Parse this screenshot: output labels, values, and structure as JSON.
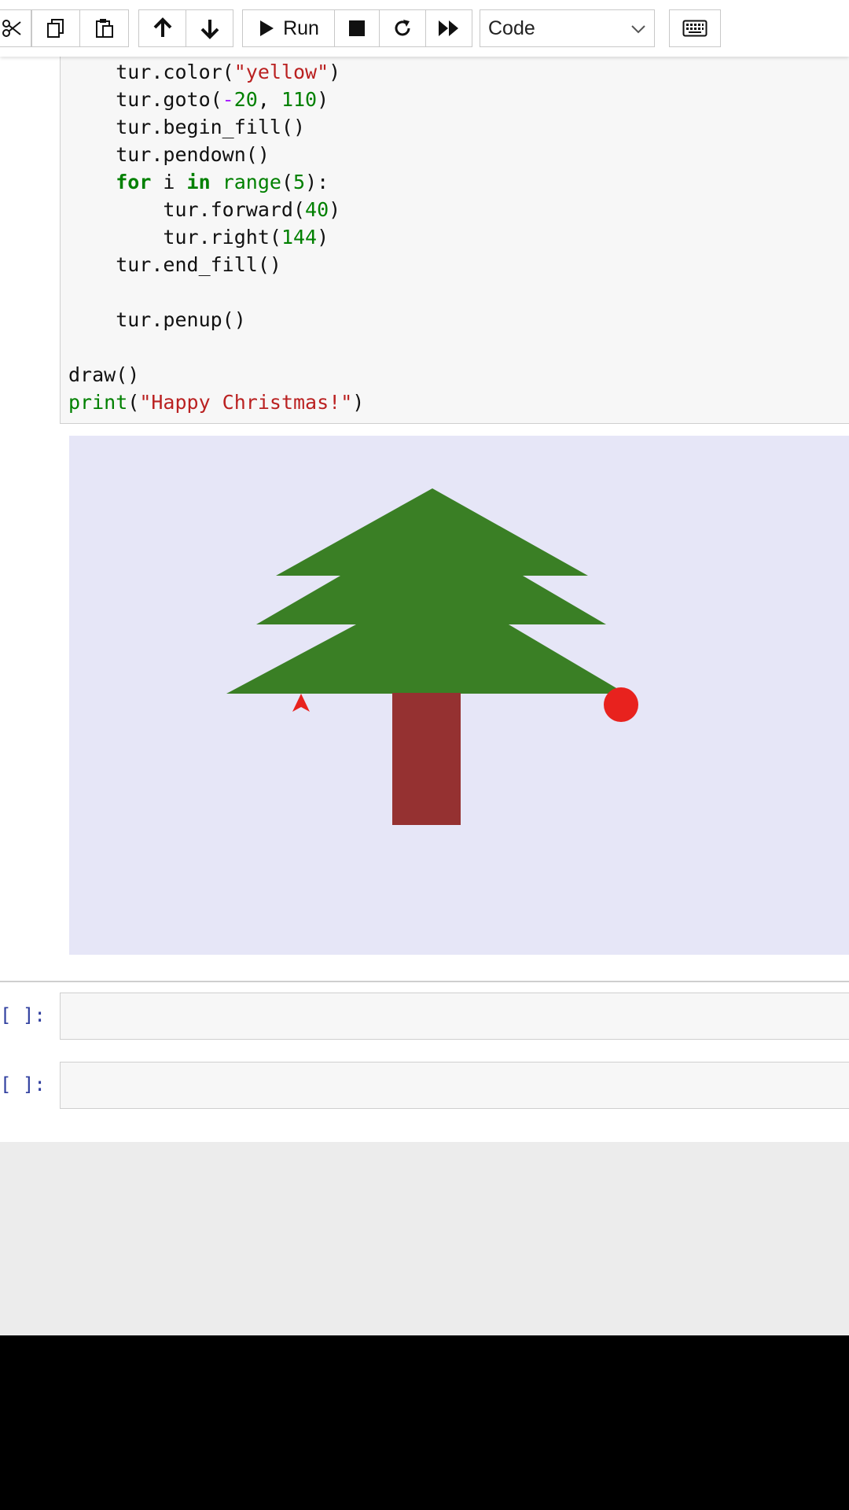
{
  "toolbar": {
    "run_label": "Run",
    "cell_type": "Code",
    "cell_type_options": [
      "Code"
    ]
  },
  "code_lines": [
    [
      {
        "t": "    tur.color("
      },
      {
        "t": "\"yellow\"",
        "c": "str"
      },
      {
        "t": ")"
      }
    ],
    [
      {
        "t": "    tur.goto("
      },
      {
        "t": "-",
        "c": "neg"
      },
      {
        "t": "20",
        "c": "num"
      },
      {
        "t": ", "
      },
      {
        "t": "110",
        "c": "num"
      },
      {
        "t": ")"
      }
    ],
    [
      {
        "t": "    tur.begin_fill()"
      }
    ],
    [
      {
        "t": "    tur.pendown()"
      }
    ],
    [
      {
        "t": "    "
      },
      {
        "t": "for",
        "c": "kw"
      },
      {
        "t": " i "
      },
      {
        "t": "in",
        "c": "kw"
      },
      {
        "t": " "
      },
      {
        "t": "range",
        "c": "bi"
      },
      {
        "t": "("
      },
      {
        "t": "5",
        "c": "num"
      },
      {
        "t": "):"
      }
    ],
    [
      {
        "t": "        tur.forward("
      },
      {
        "t": "40",
        "c": "num"
      },
      {
        "t": ")"
      }
    ],
    [
      {
        "t": "        tur.right("
      },
      {
        "t": "144",
        "c": "num"
      },
      {
        "t": ")"
      }
    ],
    [
      {
        "t": "    tur.end_fill()"
      }
    ],
    [
      {
        "t": ""
      }
    ],
    [
      {
        "t": "    tur.penup()"
      }
    ],
    [
      {
        "t": ""
      }
    ],
    [
      {
        "t": "draw()"
      }
    ],
    [
      {
        "t": "print",
        "c": "bi"
      },
      {
        "t": "("
      },
      {
        "t": "\"Happy Christmas!\"",
        "c": "str"
      },
      {
        "t": ")"
      }
    ]
  ],
  "empty_cells": [
    {
      "prompt": "[ ]:"
    },
    {
      "prompt": "[ ]:"
    }
  ],
  "colors": {
    "canvas_bg": "#e6e6f7",
    "tree_green": "#3a7f25",
    "trunk": "#953131",
    "ornament": "#e8221e",
    "turtle": "#e8221e",
    "prompt": "#303f9f"
  }
}
